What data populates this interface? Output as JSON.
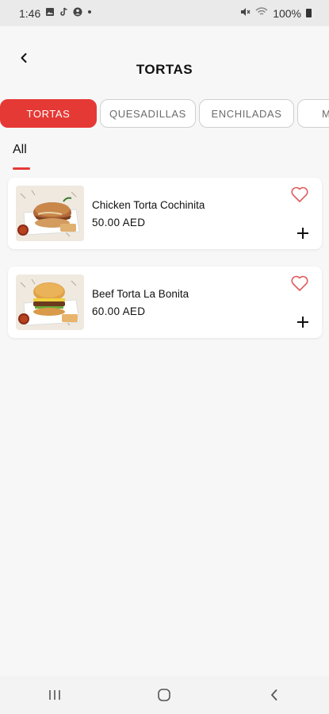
{
  "status_bar": {
    "time": "1:46",
    "left_icons": [
      "gallery-icon",
      "tiktok-icon",
      "account-icon",
      "dot-icon"
    ],
    "right_icons": [
      "mute-icon",
      "wifi-icon"
    ],
    "battery_text": "100%"
  },
  "header": {
    "title": "TORTAS",
    "back_icon": "chevron-left-icon"
  },
  "tabs": [
    {
      "label": "TORTAS",
      "active": true
    },
    {
      "label": "QUESADILLAS",
      "active": false
    },
    {
      "label": "ENCHILADAS",
      "active": false
    },
    {
      "label": "M",
      "active": false
    }
  ],
  "subcategory": {
    "label": "All",
    "accent": "#e53935"
  },
  "products": [
    {
      "name": "Chicken Torta Cochinita",
      "price": "50.00 AED",
      "favorite": false
    },
    {
      "name": "Beef Torta La Bonita",
      "price": "60.00 AED",
      "favorite": false
    }
  ],
  "nav_bar": {
    "icons": [
      "recent-apps-icon",
      "home-icon",
      "back-icon"
    ]
  },
  "colors": {
    "accent": "#e53935",
    "background": "#f7f7f7",
    "card": "#ffffff"
  }
}
